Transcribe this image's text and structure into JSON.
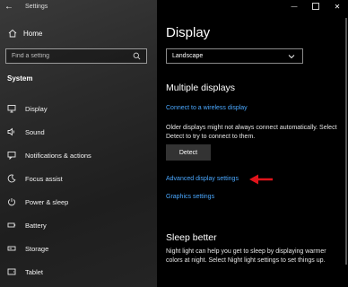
{
  "window": {
    "app_title": "Settings",
    "back_glyph": "←",
    "minimize_glyph": "—",
    "close_glyph": "✕"
  },
  "sidebar": {
    "home_label": "Home",
    "search_placeholder": "Find a setting",
    "section_heading": "System",
    "items": [
      {
        "label": "Display",
        "icon": "display-icon"
      },
      {
        "label": "Sound",
        "icon": "speaker-icon"
      },
      {
        "label": "Notifications & actions",
        "icon": "notifications-icon"
      },
      {
        "label": "Focus assist",
        "icon": "moon-icon"
      },
      {
        "label": "Power & sleep",
        "icon": "power-icon"
      },
      {
        "label": "Battery",
        "icon": "battery-icon"
      },
      {
        "label": "Storage",
        "icon": "storage-icon"
      },
      {
        "label": "Tablet",
        "icon": "tablet-icon"
      }
    ]
  },
  "main": {
    "title": "Display",
    "orientation_value": "Landscape",
    "multiple_displays": {
      "heading": "Multiple displays",
      "wireless_link": "Connect to a wireless display",
      "description": "Older displays might not always connect automatically. Select Detect to try to connect to them.",
      "detect_label": "Detect",
      "advanced_link": "Advanced display settings",
      "graphics_link": "Graphics settings"
    },
    "sleep_better": {
      "heading": "Sleep better",
      "description": "Night light can help you get to sleep by displaying warmer colors at night. Select Night light settings to set things up."
    }
  },
  "colors": {
    "accent_link": "#4aa8ff",
    "annotation_arrow": "#e0141b",
    "background": "#000000"
  }
}
